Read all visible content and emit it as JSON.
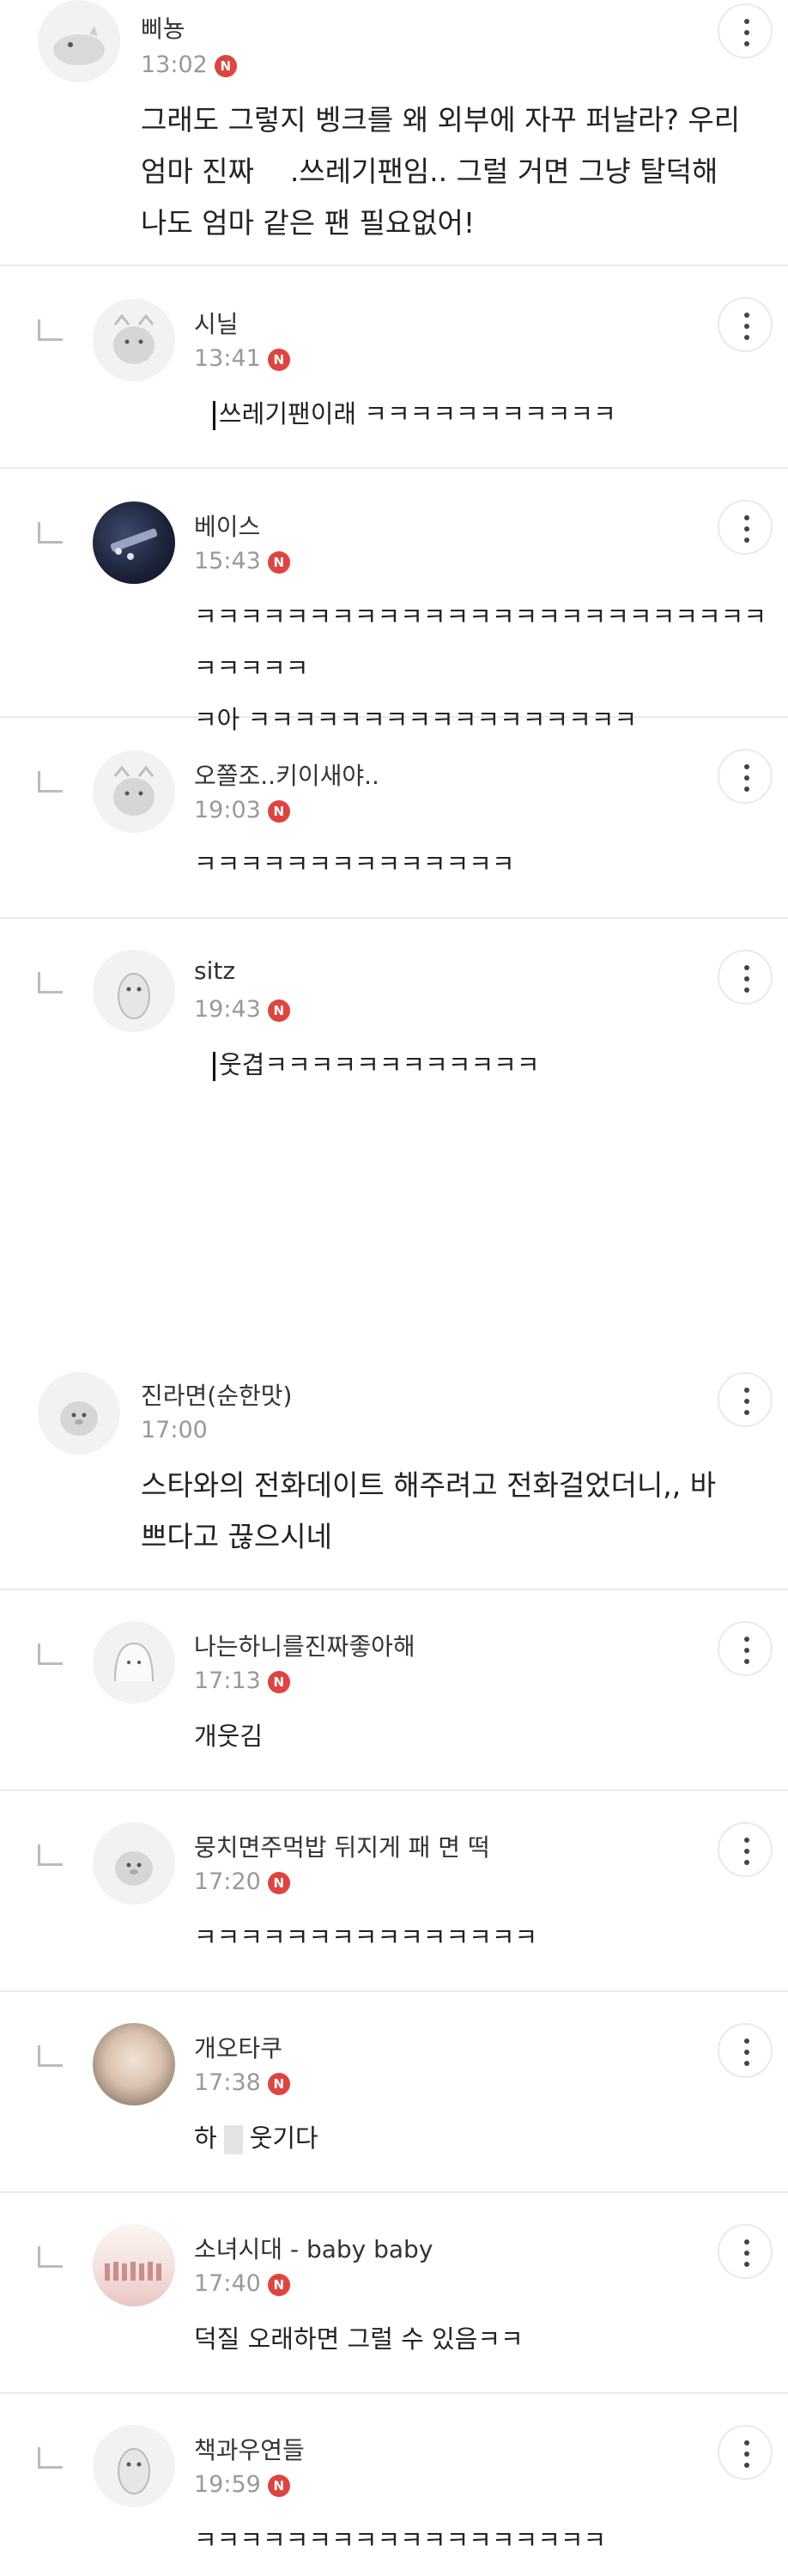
{
  "comments": [
    {
      "nick": "삐뇽",
      "time": "13:02",
      "badge": "N",
      "text": "그래도 그렇지 벵크를 왜 외부에 자꾸 퍼날라? 우리\n엄마 진짜    .쓰레기팬임.. 그럴 거면 그냥 탈덕해\n나도 엄마 같은 팬 필요없어!",
      "avatar_icon": "dinosaur-avatar-icon"
    },
    {
      "nick": "시닐",
      "time": "13:41",
      "badge": "N",
      "text": "쓰레기팬이래 ㅋㅋㅋㅋㅋㅋㅋㅋㅋㅋㅋ",
      "avatar_icon": "cat-avatar-icon"
    },
    {
      "nick": "베이스",
      "time": "15:43",
      "badge": "N",
      "text": "ㅋㅋㅋㅋㅋㅋㅋㅋㅋㅋㅋㅋㅋㅋㅋㅋㅋㅋㅋㅋㅋㅋㅋㅋㅋㅋㅋㅋㅋㅋ\nㅋ아 ㅋㅋㅋㅋㅋㅋㅋㅋㅋㅋㅋㅋㅋㅋㅋㅋㅋ",
      "avatar_icon": "bass-guitar-avatar-icon"
    },
    {
      "nick": "오쫄조..키이새야..",
      "time": "19:03",
      "badge": "N",
      "text": "ㅋㅋㅋㅋㅋㅋㅋㅋㅋㅋㅋㅋㅋㅋ",
      "avatar_icon": "cat-avatar-icon"
    },
    {
      "nick": "sitz",
      "time": "19:43",
      "badge": "N",
      "text": "웃겹ㅋㅋㅋㅋㅋㅋㅋㅋㅋㅋㅋㅋ",
      "avatar_icon": "penguin-avatar-icon"
    },
    {
      "nick": "진라면(순한맛)",
      "time": "17:00",
      "badge": "",
      "text": "스타와의 전화데이트 해주려고 전화걸었더니,, 바\n쁘다고 끊으시네",
      "avatar_icon": "duck-avatar-icon"
    },
    {
      "nick": "나는하니를진짜좋아해",
      "time": "17:13",
      "badge": "N",
      "text": "개웃김",
      "avatar_icon": "ghost-avatar-icon"
    },
    {
      "nick": "뭉치면주먹밥 뒤지게 패 면 떡",
      "time": "17:20",
      "badge": "N",
      "text": "ㅋㅋㅋㅋㅋㅋㅋㅋㅋㅋㅋㅋㅋㅋㅋ",
      "avatar_icon": "duck-avatar-icon"
    },
    {
      "nick": "개오타쿠",
      "time": "17:38",
      "badge": "N",
      "text": "웃기다",
      "prefix": "하",
      "avatar_icon": "photo-avatar-icon"
    },
    {
      "nick": "소녀시대 - baby baby",
      "time": "17:40",
      "badge": "N",
      "text": "덕질 오래하면 그럴 수 있음ㅋㅋ",
      "avatar_icon": "group-photo-avatar-icon"
    },
    {
      "nick": "책과우연들",
      "time": "19:59",
      "badge": "N",
      "text": "ㅋㅋㅋㅋㅋㅋㅋㅋㅋㅋㅋㅋㅋㅋㅋㅋㅋㅋ",
      "avatar_icon": "penguin-avatar-icon"
    }
  ]
}
